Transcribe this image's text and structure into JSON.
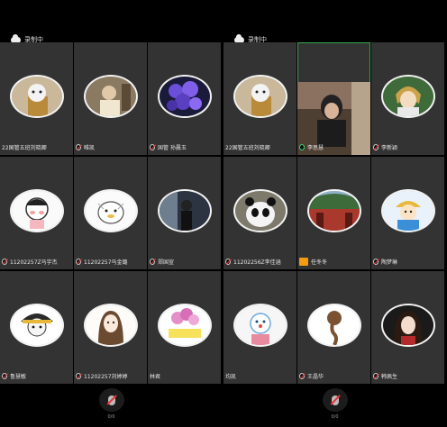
{
  "recording_label": "录制中",
  "bottom_bar": {
    "mic_label": "0/0"
  },
  "colors": {
    "tile_bg": "#333333",
    "active_border": "#2fa84f",
    "mic_muted": "#e33333"
  },
  "left": {
    "tiles": [
      {
        "name": "22国管五班刘晓卿",
        "muted": true
      },
      {
        "name": "唯凯",
        "muted": true
      },
      {
        "name": "国管 孙晨玉",
        "muted": true
      },
      {
        "name": "11202257Z马宇杰",
        "muted": true
      },
      {
        "name": "11202257马金璐",
        "muted": true
      },
      {
        "name": "郑国宣",
        "muted": true
      },
      {
        "name": "鲁慧敏",
        "muted": true
      },
      {
        "name": "11202257刘婷婷",
        "muted": true
      },
      {
        "name": "林君",
        "muted": false
      }
    ]
  },
  "right": {
    "tiles": [
      {
        "name": "22国管五班刘晓卿",
        "muted": true
      },
      {
        "name": "李思慧",
        "muted": false,
        "active": true
      },
      {
        "name": "李新颖",
        "muted": true
      },
      {
        "name": "11202256Z李佳涵",
        "muted": true
      },
      {
        "name": "任冬冬",
        "host": true
      },
      {
        "name": "陶梦琳",
        "muted": true
      },
      {
        "name": "均凯",
        "muted": false
      },
      {
        "name": "王晶华",
        "muted": true
      },
      {
        "name": "韩佩生",
        "muted": true
      }
    ]
  }
}
